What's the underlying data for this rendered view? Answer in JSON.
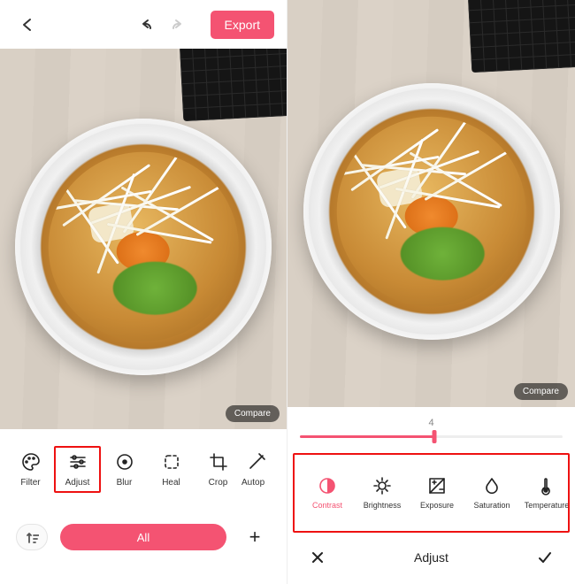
{
  "colors": {
    "accent": "#f45372",
    "highlight": "#e11"
  },
  "left": {
    "export_label": "Export",
    "compare_label": "Compare",
    "tools": [
      {
        "id": "filter",
        "label": "Filter",
        "selected": false
      },
      {
        "id": "adjust",
        "label": "Adjust",
        "selected": true
      },
      {
        "id": "blur",
        "label": "Blur",
        "selected": false
      },
      {
        "id": "heal",
        "label": "Heal",
        "selected": false
      },
      {
        "id": "crop",
        "label": "Crop",
        "selected": false
      },
      {
        "id": "autop",
        "label": "Autop",
        "selected": false
      }
    ],
    "all_label": "All"
  },
  "right": {
    "compare_label": "Compare",
    "slider_value": "4",
    "adjust_tools": [
      {
        "id": "contrast",
        "label": "Contrast",
        "active": true
      },
      {
        "id": "brightness",
        "label": "Brightness",
        "active": false
      },
      {
        "id": "exposure",
        "label": "Exposure",
        "active": false
      },
      {
        "id": "saturation",
        "label": "Saturation",
        "active": false
      },
      {
        "id": "temperature",
        "label": "Temperature",
        "active": false
      }
    ],
    "panel_title": "Adjust"
  }
}
